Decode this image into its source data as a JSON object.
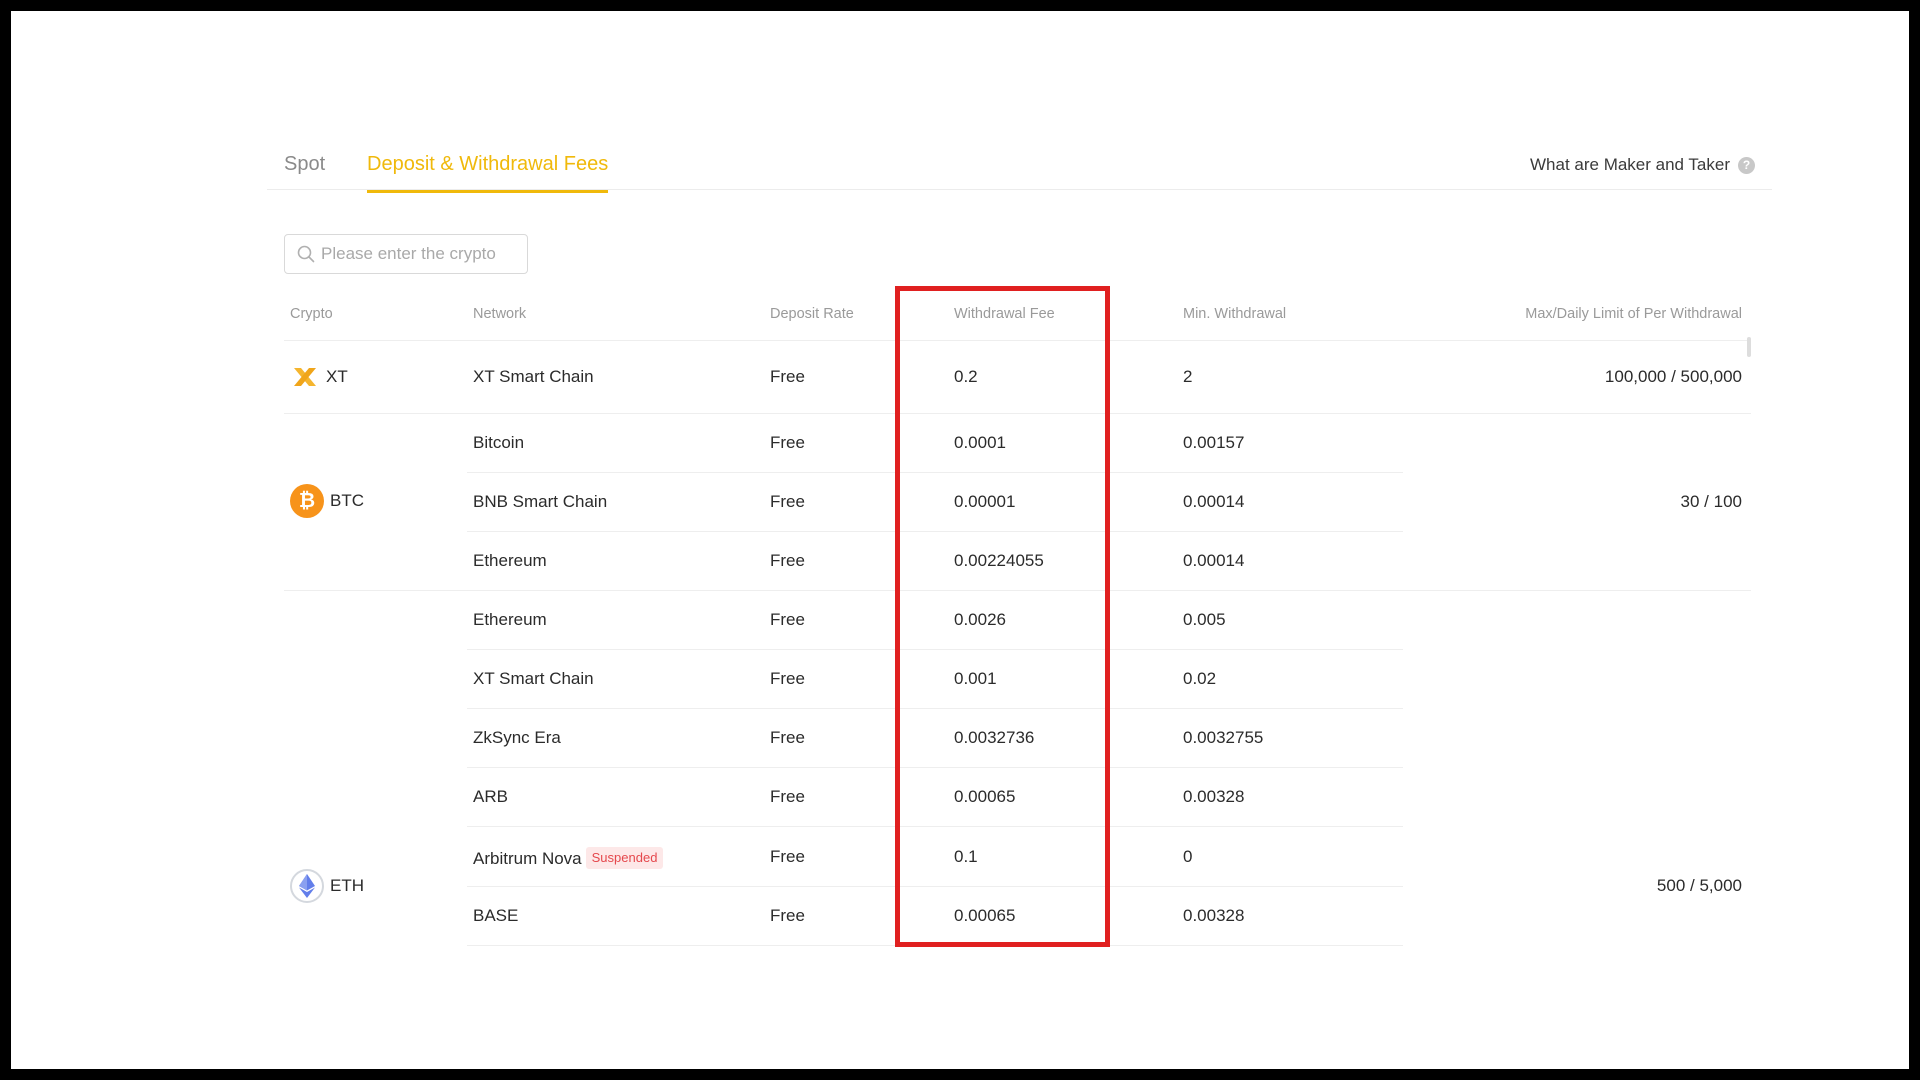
{
  "tabs": [
    {
      "label": "Spot",
      "active": false
    },
    {
      "label": "Deposit & Withdrawal Fees",
      "active": true
    }
  ],
  "help": {
    "label": "What are Maker and Taker",
    "icon": "question-circle-icon"
  },
  "search": {
    "placeholder": "Please enter the crypto",
    "value": "",
    "icon": "search-icon"
  },
  "table": {
    "headers": [
      "Crypto",
      "Network",
      "Deposit Rate",
      "Withdrawal Fee",
      "Min. Withdrawal",
      "Max/Daily Limit of Per Withdrawal"
    ],
    "groups": [
      {
        "crypto": "XT",
        "icon": "xt-logo-icon",
        "limit": "100,000 / 500,000",
        "rows": [
          {
            "network": "XT Smart Chain",
            "deposit_rate": "Free",
            "withdrawal_fee": "0.2",
            "min_withdrawal": "2"
          }
        ]
      },
      {
        "crypto": "BTC",
        "icon": "bitcoin-icon",
        "limit": "30 / 100",
        "rows": [
          {
            "network": "Bitcoin",
            "deposit_rate": "Free",
            "withdrawal_fee": "0.0001",
            "min_withdrawal": "0.00157"
          },
          {
            "network": "BNB Smart Chain",
            "deposit_rate": "Free",
            "withdrawal_fee": "0.00001",
            "min_withdrawal": "0.00014"
          },
          {
            "network": "Ethereum",
            "deposit_rate": "Free",
            "withdrawal_fee": "0.00224055",
            "min_withdrawal": "0.00014"
          }
        ]
      },
      {
        "crypto": "ETH",
        "icon": "ethereum-icon",
        "limit": "500 / 5,000",
        "rows": [
          {
            "network": "Ethereum",
            "deposit_rate": "Free",
            "withdrawal_fee": "0.0026",
            "min_withdrawal": "0.005"
          },
          {
            "network": "XT Smart Chain",
            "deposit_rate": "Free",
            "withdrawal_fee": "0.001",
            "min_withdrawal": "0.02"
          },
          {
            "network": "ZkSync Era",
            "deposit_rate": "Free",
            "withdrawal_fee": "0.0032736",
            "min_withdrawal": "0.0032755"
          },
          {
            "network": "ARB",
            "deposit_rate": "Free",
            "withdrawal_fee": "0.00065",
            "min_withdrawal": "0.00328"
          },
          {
            "network": "Arbitrum Nova",
            "badge": "Suspended",
            "deposit_rate": "Free",
            "withdrawal_fee": "0.1",
            "min_withdrawal": "0"
          },
          {
            "network": "BASE",
            "deposit_rate": "Free",
            "withdrawal_fee": "0.00065",
            "min_withdrawal": "0.00328"
          }
        ]
      }
    ]
  },
  "colors": {
    "accent": "#f0b90b",
    "highlight": "#e02020",
    "badge_text": "#e5484d",
    "badge_bg": "#fde8e8"
  }
}
